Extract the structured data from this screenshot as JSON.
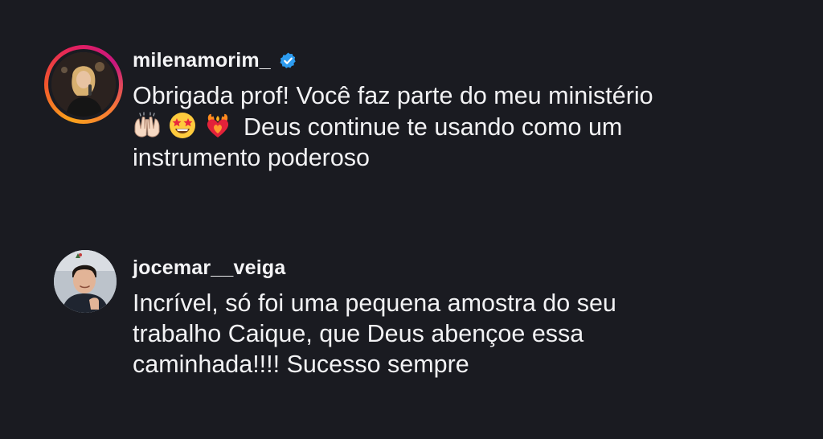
{
  "comments": [
    {
      "username": "milenamorim_",
      "verified": true,
      "avatar_icon": "profile-photo-woman",
      "lines": [
        "Obrigada prof! Você faz parte do meu ministério",
        "Deus continue te usando como um",
        "instrumento poderoso"
      ],
      "emojis": [
        "raising-hands",
        "star-struck",
        "heart-on-fire"
      ]
    },
    {
      "username": "jocemar__veiga",
      "verified": false,
      "avatar_icon": "profile-photo-man",
      "lines": [
        "Incrível, só foi uma pequena amostra do seu",
        "trabalho Caique, que Deus abençoe essa",
        "caminhada!!!! Sucesso sempre"
      ]
    }
  ],
  "colors": {
    "background": "#1a1b21",
    "text": "#f2f2f4",
    "verified_badge": "#2d9cf0",
    "story_ring": [
      "#f9a21b",
      "#e3205f",
      "#c9177e"
    ]
  }
}
